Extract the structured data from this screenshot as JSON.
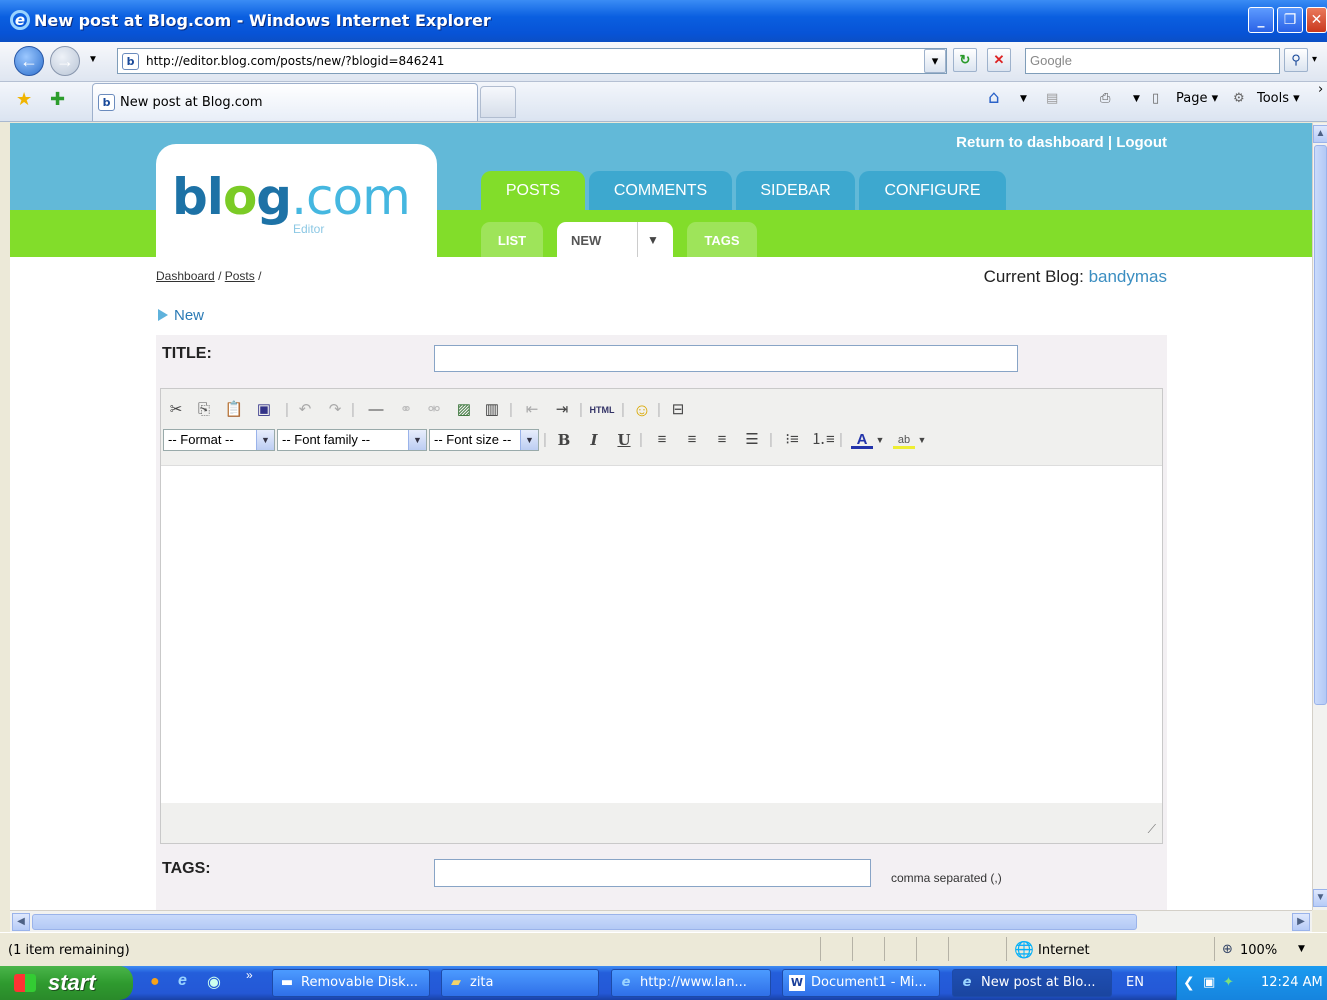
{
  "window": {
    "title": "New post at Blog.com - Windows Internet Explorer",
    "icon": "ie-icon"
  },
  "navbar": {
    "address": "http://editor.blog.com/posts/new/?blogid=846241",
    "search_placeholder": "Google"
  },
  "tabs": {
    "active_label": "New post at Blog.com"
  },
  "commandbar": {
    "page_label": "Page",
    "tools_label": "Tools"
  },
  "site": {
    "logo_blog": "bl",
    "logo_o": "o",
    "logo_g": "g",
    "logo_com": ".com",
    "logo_sub": "Editor",
    "top_links": "Return to dashboard | Logout",
    "main_tabs": [
      "POSTS",
      "COMMENTS",
      "SIDEBAR",
      "CONFIGURE"
    ],
    "sub_tabs": [
      "LIST",
      "NEW",
      "TAGS"
    ],
    "breadcrumb": {
      "dashboard": "Dashboard",
      "sep1": "/",
      "posts": "Posts",
      "sep2": "/"
    },
    "current_blog_label": "Current Blog:",
    "current_blog_value": "bandymas",
    "section_title": "New"
  },
  "form": {
    "title_label": "TITLE:",
    "title_value": "",
    "tags_label": "TAGS:",
    "tags_value": "",
    "tags_hint": "comma separated (,)"
  },
  "editor": {
    "format_select": "-- Format --",
    "font_family_select": "-- Font family --",
    "font_size_select": "-- Font size --",
    "bold": "B",
    "italic": "I",
    "underline": "U",
    "html_button": "HTML"
  },
  "statusbar": {
    "status_text": "(1 item remaining)",
    "zone": "Internet",
    "zoom": "100%"
  },
  "taskbar": {
    "start": "start",
    "buttons": [
      "Removable Disk...",
      "zita",
      "http://www.lan...",
      "Document1 - Mi...",
      "New post at Blo..."
    ],
    "language": "EN",
    "clock": "12:24 AM"
  },
  "colors": {
    "site_blue": "#62b9d8",
    "site_green": "#82dd2a",
    "link_blue": "#3b8ec1",
    "xp_blue": "#245edb"
  }
}
